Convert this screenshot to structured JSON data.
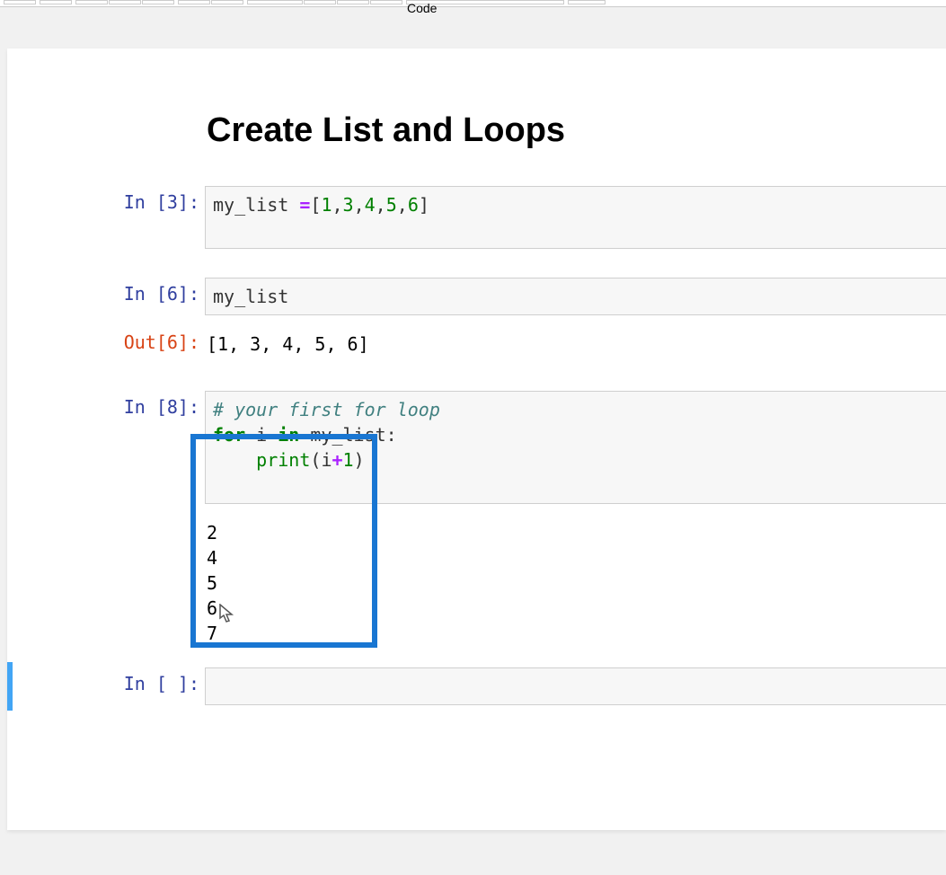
{
  "toolbar": {
    "dropdown_value": "Code"
  },
  "notebook": {
    "heading": "Create List and Loops",
    "cells": {
      "c1": {
        "in_label": "In [3]:",
        "code": {
          "raw": "my_list =[1,3,4,5,6]",
          "var": "my_list",
          "assign": " =",
          "lb": "[",
          "n1": "1",
          "n2": "3",
          "n3": "4",
          "n4": "5",
          "n5": "6",
          "comma": ",",
          "rb": "]"
        }
      },
      "c2": {
        "in_label": "In [6]:",
        "code": {
          "var": "my_list"
        },
        "out_label": "Out[6]:",
        "output": "[1, 3, 4, 5, 6]"
      },
      "c3": {
        "in_label": "In [8]:",
        "code": {
          "comment": "# your first for loop",
          "kw_for": "for",
          "iter": " i ",
          "kw_in": "in",
          "iter2": " my_list:",
          "indent": "    ",
          "print": "print",
          "lp": "(",
          "arg_i": "i",
          "plus": "+",
          "one": "1",
          "rp": ")"
        },
        "output": "2\n4\n5\n6\n7"
      },
      "c4": {
        "in_label": "In [ ]:"
      }
    }
  }
}
